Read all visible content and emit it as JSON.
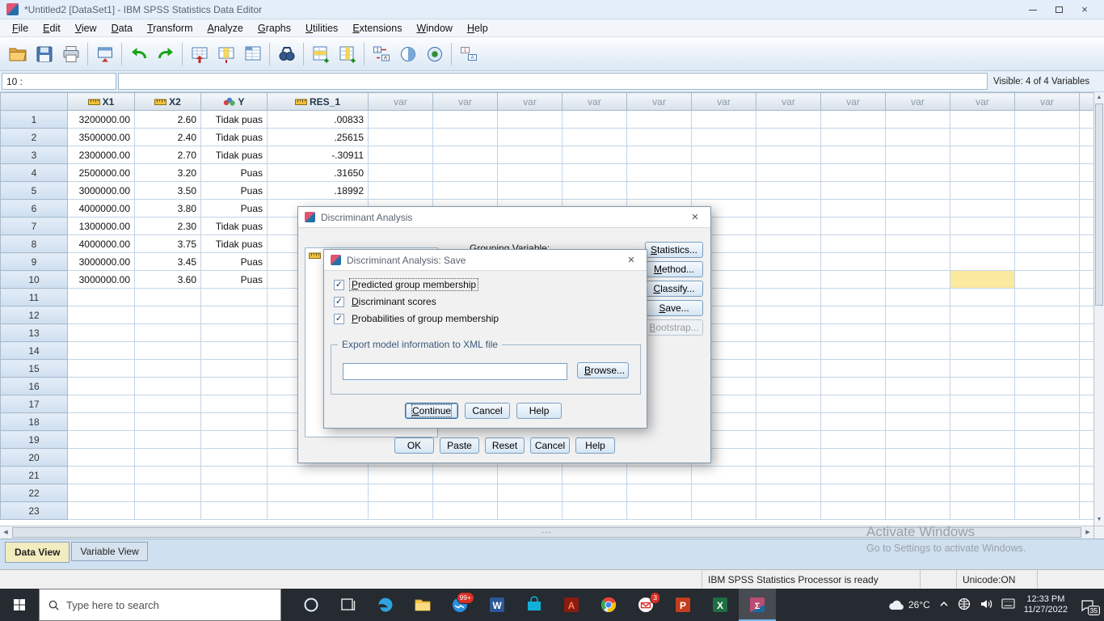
{
  "titlebar": {
    "title": "*Untitled2 [DataSet1] - IBM SPSS Statistics Data Editor"
  },
  "menubar": {
    "items": [
      "File",
      "Edit",
      "View",
      "Data",
      "Transform",
      "Analyze",
      "Graphs",
      "Utilities",
      "Extensions",
      "Window",
      "Help"
    ]
  },
  "toolbar": {
    "buttons": [
      "open",
      "save",
      "print",
      "|",
      "recall-dialogs",
      "|",
      "undo",
      "redo",
      "|",
      "goto-case",
      "goto-variable",
      "variables",
      "|",
      "find",
      "|",
      "insert-cases",
      "insert-variable",
      "|",
      "split-file",
      "weight-cases",
      "select-cases",
      "|",
      "value-labels"
    ]
  },
  "cellref": {
    "row_label": "10 :",
    "visible_info": "Visible: 4 of 4 Variables"
  },
  "grid": {
    "columns": [
      {
        "label": "X1",
        "measure": "scale"
      },
      {
        "label": "X2",
        "measure": "scale"
      },
      {
        "label": "Y",
        "measure": "nominal"
      },
      {
        "label": "RES_1",
        "measure": "scale"
      }
    ],
    "var_label": "var",
    "var_column_count": 12,
    "active_cell": {
      "row": 10,
      "var_col": 10
    },
    "rows": [
      {
        "n": "1",
        "cells": [
          "3200000.00",
          "2.60",
          "Tidak puas",
          ".00833"
        ]
      },
      {
        "n": "2",
        "cells": [
          "3500000.00",
          "2.40",
          "Tidak puas",
          ".25615"
        ]
      },
      {
        "n": "3",
        "cells": [
          "2300000.00",
          "2.70",
          "Tidak puas",
          "-.30911"
        ]
      },
      {
        "n": "4",
        "cells": [
          "2500000.00",
          "3.20",
          "Puas",
          ".31650"
        ]
      },
      {
        "n": "5",
        "cells": [
          "3000000.00",
          "3.50",
          "Puas",
          ".18992"
        ]
      },
      {
        "n": "6",
        "cells": [
          "4000000.00",
          "3.80",
          "Puas",
          ""
        ]
      },
      {
        "n": "7",
        "cells": [
          "1300000.00",
          "2.30",
          "Tidak puas",
          ""
        ]
      },
      {
        "n": "8",
        "cells": [
          "4000000.00",
          "3.75",
          "Tidak puas",
          ""
        ]
      },
      {
        "n": "9",
        "cells": [
          "3000000.00",
          "3.45",
          "Puas",
          ""
        ]
      },
      {
        "n": "10",
        "cells": [
          "3000000.00",
          "3.60",
          "Puas",
          ""
        ]
      },
      {
        "n": "11",
        "cells": [
          "",
          "",
          "",
          ""
        ]
      },
      {
        "n": "12",
        "cells": [
          "",
          "",
          "",
          ""
        ]
      },
      {
        "n": "13",
        "cells": [
          "",
          "",
          "",
          ""
        ]
      },
      {
        "n": "14",
        "cells": [
          "",
          "",
          "",
          ""
        ]
      },
      {
        "n": "15",
        "cells": [
          "",
          "",
          "",
          ""
        ]
      },
      {
        "n": "16",
        "cells": [
          "",
          "",
          "",
          ""
        ]
      },
      {
        "n": "17",
        "cells": [
          "",
          "",
          "",
          ""
        ]
      },
      {
        "n": "18",
        "cells": [
          "",
          "",
          "",
          ""
        ]
      },
      {
        "n": "19",
        "cells": [
          "",
          "",
          "",
          ""
        ]
      },
      {
        "n": "20",
        "cells": [
          "",
          "",
          "",
          ""
        ]
      },
      {
        "n": "21",
        "cells": [
          "",
          "",
          "",
          ""
        ]
      },
      {
        "n": "22",
        "cells": [
          "",
          "",
          "",
          ""
        ]
      },
      {
        "n": "23",
        "cells": [
          "",
          "",
          "",
          ""
        ]
      }
    ]
  },
  "dialog_discriminant": {
    "title": "Discriminant Analysis",
    "grouping_label": "Grouping Variable:",
    "side_buttons": [
      {
        "label": "Statistics...",
        "enabled": true
      },
      {
        "label": "Method...",
        "enabled": true
      },
      {
        "label": "Classify...",
        "enabled": true
      },
      {
        "label": "Save...",
        "enabled": true
      },
      {
        "label": "Bootstrap...",
        "enabled": false
      }
    ],
    "bottom_buttons": [
      "OK",
      "Paste",
      "Reset",
      "Cancel",
      "Help"
    ]
  },
  "dialog_save": {
    "title": "Discriminant Analysis: Save",
    "checkboxes": [
      {
        "label": "Predicted group membership",
        "checked": true
      },
      {
        "label": "Discriminant scores",
        "checked": true
      },
      {
        "label": "Probabilities of group membership",
        "checked": true
      }
    ],
    "group_label": "Export model information to XML file",
    "xml_path_value": "",
    "browse_label": "Browse...",
    "buttons": [
      "Continue",
      "Cancel",
      "Help"
    ]
  },
  "view_tabs": {
    "data_view": "Data View",
    "variable_view": "Variable View"
  },
  "statusbar": {
    "processor": "IBM SPSS Statistics Processor is ready",
    "unicode": "Unicode:ON"
  },
  "watermark": {
    "line1": "Activate Windows",
    "line2": "Go to Settings to activate Windows."
  },
  "taskbar": {
    "search_placeholder": "Type here to search",
    "apps": [
      {
        "name": "cortana"
      },
      {
        "name": "task-view"
      },
      {
        "name": "edge"
      },
      {
        "name": "file-explorer"
      },
      {
        "name": "messenger",
        "badge": "99+"
      },
      {
        "name": "word"
      },
      {
        "name": "store"
      },
      {
        "name": "adobe"
      },
      {
        "name": "chrome"
      },
      {
        "name": "mail",
        "badge": "3"
      },
      {
        "name": "powerpoint"
      },
      {
        "name": "excel"
      },
      {
        "name": "spss",
        "active": true
      }
    ],
    "weather": "26°C",
    "clock": {
      "time": "12:33 PM",
      "date": "11/27/2022"
    },
    "notification_count": "35"
  },
  "colors": {
    "titlebar_bg": "#e4eefa",
    "active_cell": "#fbe9a0",
    "data_view_tab_bg": "#f3ecc0",
    "taskbar_bg": "#262a31"
  }
}
